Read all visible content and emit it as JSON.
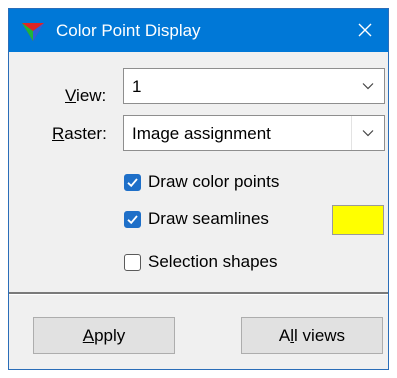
{
  "window": {
    "title": "Color Point Display",
    "icon": "app-triangle-icon",
    "close_icon": "close-icon",
    "accent": "#0078d7"
  },
  "view": {
    "label_mnemonic": "V",
    "label_rest": "iew:",
    "value": "1"
  },
  "raster": {
    "label_mnemonic": "R",
    "label_rest": "aster:",
    "value": "Image assignment"
  },
  "options": [
    {
      "label": "Draw color points",
      "checked": true
    },
    {
      "label": "Draw seamlines",
      "checked": true
    },
    {
      "label": "Selection shapes",
      "checked": false
    }
  ],
  "seamline_color": "#ffff00",
  "buttons": {
    "apply_mnemonic": "A",
    "apply_rest": "pply",
    "allviews_pre": "A",
    "allviews_mnemonic": "l",
    "allviews_rest": "l views"
  }
}
